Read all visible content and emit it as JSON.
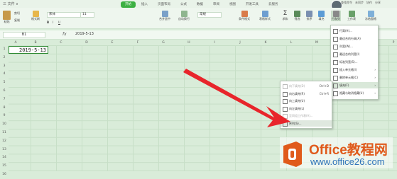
{
  "window": {
    "file_tab": "三 文件 ∨"
  },
  "menu": {
    "tabs": [
      "开始",
      "插入",
      "页面布局",
      "公式",
      "数据",
      "审阅",
      "视图",
      "开发工具",
      "云服务"
    ],
    "right": [
      "查找命令",
      "未同步",
      "协作",
      "分享"
    ]
  },
  "ribbon": {
    "paste": "粘贴",
    "cut": "剪切",
    "copy": "复制",
    "format_painter": "格式刷",
    "font": "宋体",
    "size": "11",
    "merge": "合并居中",
    "wrap": "自动换行",
    "number_format": "常规",
    "cond_format": "条件格式",
    "table_style": "表格样式",
    "sum": "求和",
    "filter": "筛选",
    "sort": "排序",
    "fill": "填充",
    "row_col": "行和列",
    "worksheet": "工作表",
    "freeze": "冻结窗格"
  },
  "formula_bar": {
    "name_box": "B1",
    "fx": "fx",
    "value": "2019-5-13"
  },
  "sheet": {
    "columns": [
      "A",
      "B",
      "C",
      "D",
      "E",
      "F",
      "G",
      "H",
      "I",
      "J",
      "K",
      "L",
      "M",
      "N",
      "O",
      "P"
    ],
    "rows": [
      "1",
      "2",
      "3",
      "4",
      "5",
      "6",
      "7",
      "8",
      "9",
      "10",
      "11",
      "12",
      "13",
      "14",
      "15",
      "16"
    ],
    "selected_value": "2019-5-13"
  },
  "dropdown": {
    "items": [
      {
        "label": "行高(H)...",
        "arrow": ""
      },
      {
        "label": "最适合的行高(A)",
        "arrow": ""
      },
      {
        "label": "列宽(W)...",
        "arrow": ""
      },
      {
        "label": "最适合的列宽(I)",
        "arrow": ""
      },
      {
        "label": "标准列宽(S)...",
        "arrow": ""
      },
      {
        "label": "插入单元格(I)",
        "arrow": "›"
      },
      {
        "label": "删除单元格(C)",
        "arrow": "›"
      },
      {
        "label": "填充(F)",
        "arrow": "›"
      },
      {
        "label": "隐藏与取消隐藏(U)",
        "arrow": "›"
      }
    ]
  },
  "submenu": {
    "items": [
      {
        "label": "向下填充(D)",
        "shortcut": "Ctrl+D",
        "disabled": true
      },
      {
        "label": "向右填充(R)",
        "shortcut": "Ctrl+R",
        "disabled": false
      },
      {
        "label": "向上填充(U)",
        "shortcut": "",
        "disabled": false
      },
      {
        "label": "向左填充(L)",
        "shortcut": "",
        "disabled": false
      },
      {
        "label": "至同组工作表(A)...",
        "shortcut": "",
        "disabled": true
      },
      {
        "label": "序列(S)...",
        "shortcut": "",
        "disabled": false
      }
    ]
  },
  "watermark": {
    "title": "Office教程网",
    "url": "www.office26.com"
  },
  "colors": {
    "accent": "#3cb042",
    "arrow": "#e8252b",
    "logo_orange": "#e05a1b",
    "logo_blue": "#2f73b9"
  }
}
